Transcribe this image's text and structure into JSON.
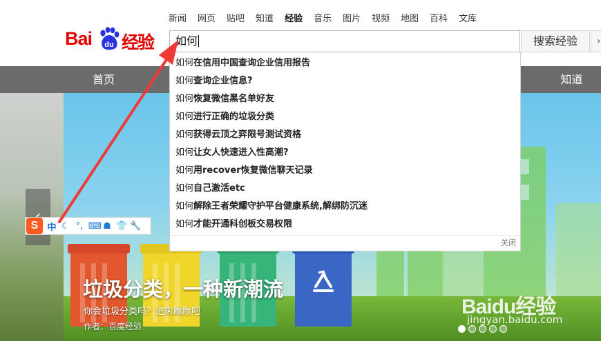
{
  "top_nav": [
    "新闻",
    "网页",
    "贴吧",
    "知道",
    "经验",
    "音乐",
    "图片",
    "视频",
    "地图",
    "百科",
    "文库"
  ],
  "top_nav_active": "经验",
  "logo": {
    "bai": "Bai",
    "du": "du",
    "cn": "经验"
  },
  "search": {
    "value": "如何",
    "button_label": "搜索经验"
  },
  "main_nav": {
    "home": "首页",
    "zhidao": "知道"
  },
  "suggestions": [
    {
      "prefix": "如何",
      "rest": "在信用中国查询企业信用报告"
    },
    {
      "prefix": "如何",
      "rest": "查询企业信息?"
    },
    {
      "prefix": "如何",
      "rest": "恢复微信黑名单好友"
    },
    {
      "prefix": "如何",
      "rest": "进行正确的垃圾分类"
    },
    {
      "prefix": "如何",
      "rest": "获得云顶之弈限号测试资格"
    },
    {
      "prefix": "如何",
      "rest": "让女人快速进入性高潮?"
    },
    {
      "prefix": "如何",
      "rest": "用recover恢复微信聊天记录"
    },
    {
      "prefix": "如何",
      "rest": "自己激活etc"
    },
    {
      "prefix": "如何",
      "rest": "解除王者荣耀守护平台健康系统,解绑防沉迷"
    },
    {
      "prefix": "如何",
      "rest": "才能开通科创板交易权限"
    }
  ],
  "suggest_close": "关闭",
  "banner": {
    "title": "垃圾分类，一种新潮流",
    "subtitle": "你会垃圾分类吗？进来瞧瞧吧",
    "author": "作者：百度经验",
    "watermark": "Baidu经验",
    "watermark_url": "jingyan.baidu.com",
    "active_slide": 1,
    "slide_count": 5
  },
  "ime": {
    "logo": "S",
    "mode": "中"
  },
  "colors": {
    "brand_red": "#e10601",
    "nav_band": "#6b6b6b",
    "arrow": "#f03a35"
  }
}
